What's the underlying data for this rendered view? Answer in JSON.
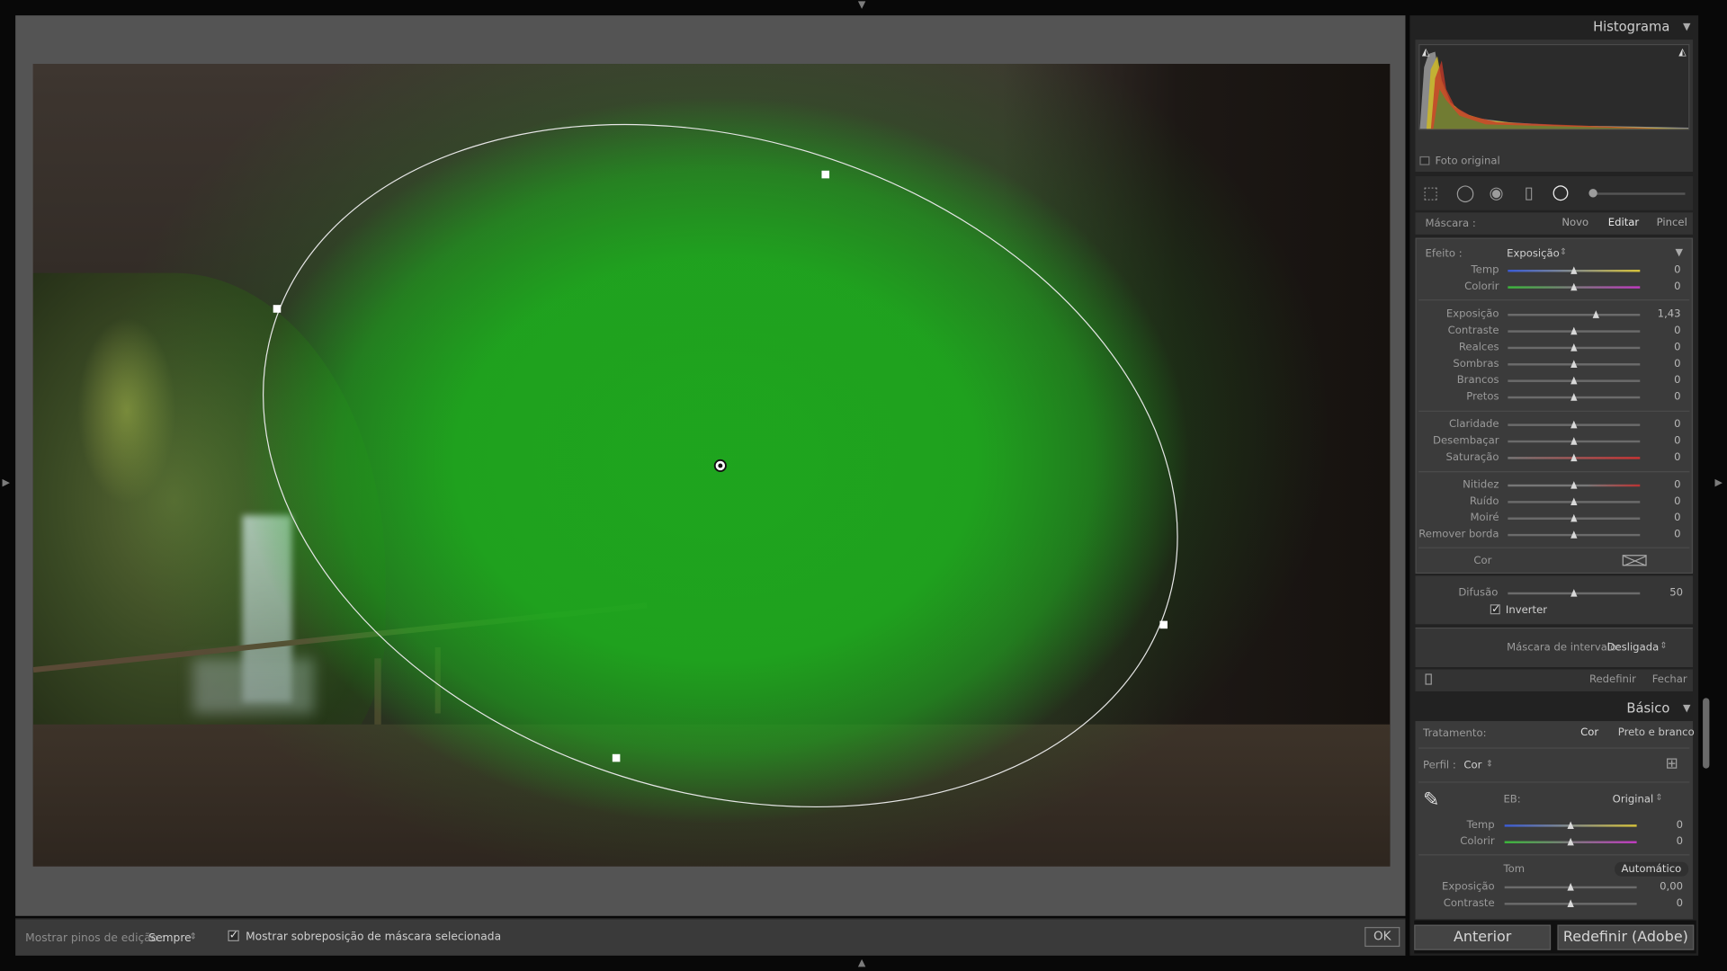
{
  "toolbar": {
    "show_pins_label": "Mostrar pinos de edição :",
    "show_pins_value": "Sempre",
    "overlay_checked": true,
    "overlay_label": "Mostrar sobreposição de máscara selecionada",
    "ok_label": "OK"
  },
  "histogram": {
    "title": "Histograma",
    "original_photo_label": "Foto original"
  },
  "mask": {
    "label": "Máscara :",
    "new_label": "Novo",
    "edit_label": "Editar",
    "brush_label": "Pincel"
  },
  "effect": {
    "label": "Efeito :",
    "value": "Exposição"
  },
  "mask_sliders": [
    {
      "label": "Temp",
      "value": "0",
      "level": 0.5,
      "style": "temp"
    },
    {
      "label": "Colorir",
      "value": "0",
      "level": 0.5,
      "style": "tint"
    },
    {
      "label": "Exposição",
      "value": "1,43",
      "level": 0.67,
      "style": "plain"
    },
    {
      "label": "Contraste",
      "value": "0",
      "level": 0.5,
      "style": "plain"
    },
    {
      "label": "Realces",
      "value": "0",
      "level": 0.5,
      "style": "plain"
    },
    {
      "label": "Sombras",
      "value": "0",
      "level": 0.5,
      "style": "plain"
    },
    {
      "label": "Brancos",
      "value": "0",
      "level": 0.5,
      "style": "plain"
    },
    {
      "label": "Pretos",
      "value": "0",
      "level": 0.5,
      "style": "plain"
    },
    {
      "label": "Claridade",
      "value": "0",
      "level": 0.5,
      "style": "plain"
    },
    {
      "label": "Desembaçar",
      "value": "0",
      "level": 0.5,
      "style": "plain"
    },
    {
      "label": "Saturação",
      "value": "0",
      "level": 0.5,
      "style": "sat"
    },
    {
      "label": "Nitidez",
      "value": "0",
      "level": 0.5,
      "style": "red"
    },
    {
      "label": "Ruído",
      "value": "0",
      "level": 0.5,
      "style": "plain"
    },
    {
      "label": "Moiré",
      "value": "0",
      "level": 0.5,
      "style": "plain"
    },
    {
      "label": "Remover borda",
      "value": "0",
      "level": 0.5,
      "style": "plain"
    }
  ],
  "color_label": "Cor",
  "feather": {
    "label": "Difusão",
    "value": "50",
    "level": 0.5
  },
  "invert": {
    "label": "Inverter",
    "checked": true
  },
  "range_mask": {
    "label": "Máscara de intervalo:",
    "value": "Desligada"
  },
  "mask_footer": {
    "reset_label": "Redefinir",
    "close_label": "Fechar"
  },
  "basic": {
    "title": "Básico",
    "treatment_label": "Tratamento:",
    "treatment_color": "Cor",
    "treatment_bw": "Preto e branco",
    "profile_label": "Perfil :",
    "profile_value": "Cor",
    "wb_label": "EB:",
    "wb_value": "Original",
    "sliders": [
      {
        "label": "Temp",
        "value": "0",
        "level": 0.5,
        "style": "temp"
      },
      {
        "label": "Colorir",
        "value": "0",
        "level": 0.5,
        "style": "tint"
      }
    ],
    "tone_label": "Tom",
    "auto_label": "Automático",
    "tone_sliders": [
      {
        "label": "Exposição",
        "value": "0,00",
        "level": 0.5,
        "style": "plain"
      },
      {
        "label": "Contraste",
        "value": "0",
        "level": 0.5,
        "style": "plain"
      }
    ]
  },
  "buttons": {
    "previous": "Anterior",
    "reset_adobe": "Redefinir (Adobe)"
  },
  "colors": {
    "mask_overlay": "#1fb21f",
    "panel_bg": "#3b3b3b",
    "canvas_bg": "#545454"
  }
}
